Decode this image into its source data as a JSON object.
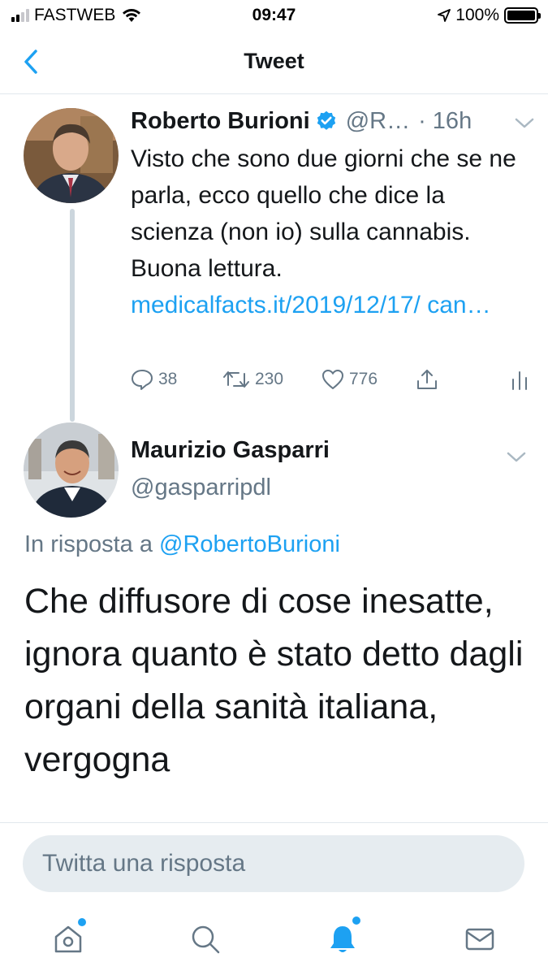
{
  "status_bar": {
    "carrier": "FASTWEB",
    "time": "09:47",
    "battery_percent": "100%",
    "battery_level": 1.0,
    "signal_bars": 2
  },
  "nav": {
    "title": "Tweet",
    "back_icon": "chevron-left-icon"
  },
  "tweet1": {
    "author_name": "Roberto Burioni",
    "verified": true,
    "handle": "@R…",
    "time": "· 16h",
    "text": "Visto che sono due giorni che se ne parla, ecco quello che dice la scienza (non io) sulla cannabis. Buona lettura.",
    "link": "medicalfacts.it/2019/12/17/ can…",
    "actions": {
      "replies": "38",
      "retweets": "230",
      "likes": "776"
    }
  },
  "tweet2": {
    "author_name": "Maurizio Gasparri",
    "handle": "@gasparripdl",
    "reply_prefix": "In risposta a",
    "reply_mention": "@RobertoBurioni",
    "text": "Che diffusore di cose inesatte, ignora quanto è stato detto dagli organi della sanità italiana, vergogna"
  },
  "reply_box": {
    "placeholder": "Twitta una risposta"
  },
  "tab_bar": {
    "items": [
      {
        "icon": "home-icon",
        "has_dot": true
      },
      {
        "icon": "search-icon",
        "has_dot": false
      },
      {
        "icon": "notifications-icon",
        "has_dot": true,
        "active": true
      },
      {
        "icon": "messages-icon",
        "has_dot": false
      }
    ]
  },
  "colors": {
    "accent": "#1da1f2",
    "text_primary": "#14171a",
    "text_secondary": "#657786",
    "divider": "#e1e8ed",
    "input_bg": "#e6ecf0"
  }
}
